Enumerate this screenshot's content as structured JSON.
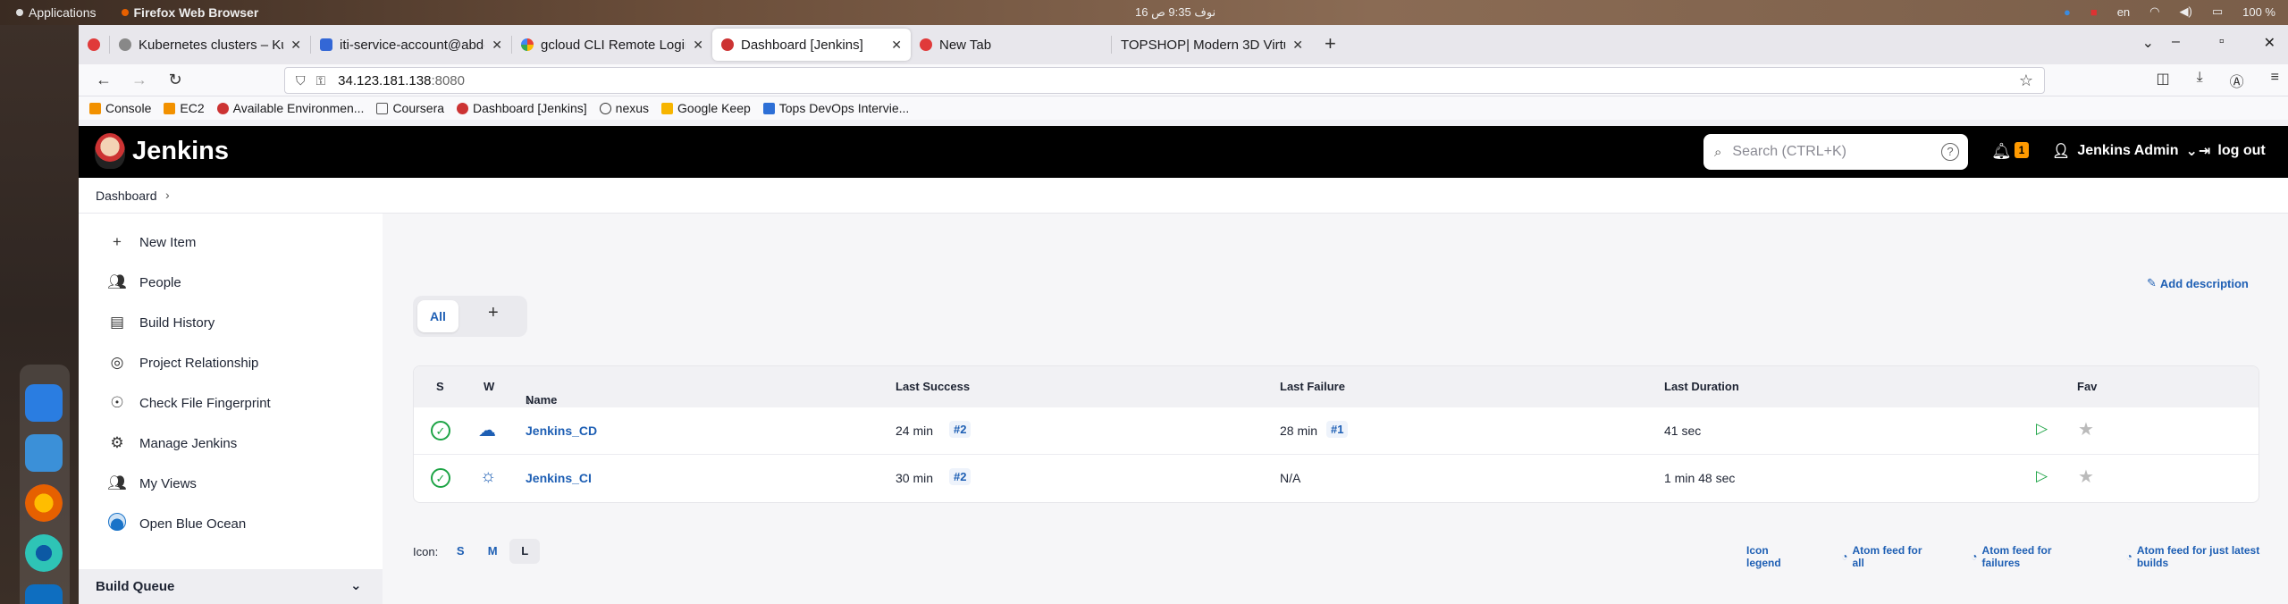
{
  "desktop": {
    "activities_label": "Applications",
    "app_name": "Firefox Web Browser",
    "clock": "16 نوف  9:35 ص",
    "language": "en",
    "battery": "100 %"
  },
  "tabs": [
    {
      "title": "",
      "active": false
    },
    {
      "title": "Kubernetes clusters – Kube",
      "active": false
    },
    {
      "title": "iti-service-account@abde",
      "active": false
    },
    {
      "title": "gcloud CLI Remote Login",
      "active": false
    },
    {
      "title": "Dashboard [Jenkins]",
      "active": true
    },
    {
      "title": "New Tab",
      "active": false
    },
    {
      "title": "TOPSHOP| Modern 3D Virtu",
      "active": false
    }
  ],
  "url": {
    "host": "34.123.181.138",
    "port": ":8080"
  },
  "bookmarks": [
    "Console",
    "EC2",
    "Available Environmen...",
    "Coursera",
    "Dashboard [Jenkins]",
    "nexus",
    "Google Keep",
    "Tops DevOps Intervie..."
  ],
  "jenkins": {
    "brand": "Jenkins",
    "search_placeholder": "Search (CTRL+K)",
    "notification_count": "1",
    "user": "Jenkins Admin",
    "logout": "log out",
    "breadcrumb": "Dashboard",
    "sidebar": [
      {
        "label": "New Item",
        "icon": "plus-icon"
      },
      {
        "label": "People",
        "icon": "people-icon"
      },
      {
        "label": "Build History",
        "icon": "history-icon"
      },
      {
        "label": "Project Relationship",
        "icon": "relationship-icon"
      },
      {
        "label": "Check File Fingerprint",
        "icon": "fingerprint-icon"
      },
      {
        "label": "Manage Jenkins",
        "icon": "gear-icon"
      },
      {
        "label": "My Views",
        "icon": "views-icon"
      },
      {
        "label": "Open Blue Ocean",
        "icon": "blue-ocean-icon"
      }
    ],
    "build_queue": "Build Queue",
    "add_description": "Add description",
    "view_tab": "All",
    "columns": {
      "s": "S",
      "w": "W",
      "name": "Name",
      "sort_arrow": "↓",
      "last_success": "Last Success",
      "last_failure": "Last Failure",
      "last_duration": "Last Duration",
      "fav": "Fav"
    },
    "jobs": [
      {
        "name": "Jenkins_CD",
        "weather": "cloudy",
        "last_success": "24 min",
        "success_build": "#2",
        "last_failure": "28 min",
        "failure_build": "#1",
        "last_duration": "41 sec"
      },
      {
        "name": "Jenkins_CI",
        "weather": "sunny",
        "last_success": "30 min",
        "success_build": "#2",
        "last_failure": "N/A",
        "failure_build": "",
        "last_duration": "1 min 48 sec"
      }
    ],
    "icon_label": "Icon:",
    "icon_sizes": [
      "S",
      "M",
      "L"
    ],
    "selected_icon_size": "L",
    "feeds": [
      "Icon legend",
      "Atom feed for all",
      "Atom feed for failures",
      "Atom feed for just latest builds"
    ]
  },
  "colors": {
    "header_bg": "#000000",
    "link": "#1e5fb4",
    "success": "#1ea446",
    "badge": "#ff9a00"
  }
}
